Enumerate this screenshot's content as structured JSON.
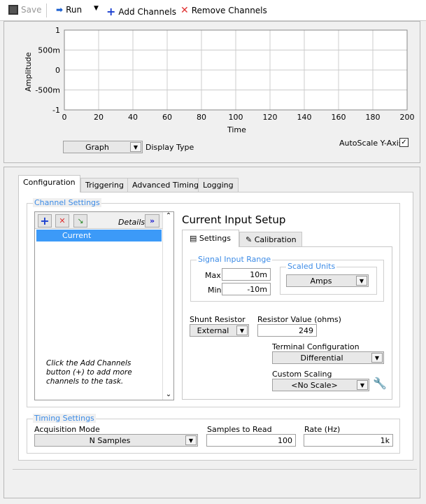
{
  "toolbar": {
    "save": "Save",
    "run": "Run",
    "add_channels": "Add Channels",
    "remove_channels": "Remove Channels"
  },
  "graph": {
    "y_label": "Amplitude",
    "x_label": "Time",
    "y_ticks": [
      "1",
      "500m",
      "0",
      "-500m",
      "-1"
    ],
    "x_ticks": [
      "0",
      "20",
      "40",
      "60",
      "80",
      "100",
      "120",
      "140",
      "160",
      "180",
      "200"
    ],
    "display_type_value": "Graph",
    "display_type_label": "Display Type",
    "autoscale_label": "AutoScale Y-Axis",
    "autoscale_checked": true
  },
  "tabs": [
    "Configuration",
    "Triggering",
    "Advanced Timing",
    "Logging"
  ],
  "channel_settings": {
    "title": "Channel Settings",
    "details": "Details",
    "channels": [
      "Current"
    ],
    "hint": "Click the Add Channels button (+) to add more channels to the task."
  },
  "setup": {
    "title": "Current Input Setup",
    "tabs": [
      "Settings",
      "Calibration"
    ],
    "signal_range": "Signal Input Range",
    "max_label": "Max",
    "max": "10m",
    "min_label": "Min",
    "min": "-10m",
    "scaled_units_label": "Scaled Units",
    "scaled_units": "Amps",
    "shunt_label": "Shunt Resistor",
    "shunt": "External",
    "resistor_label": "Resistor Value (ohms)",
    "resistor": "249",
    "terminal_label": "Terminal Configuration",
    "terminal": "Differential",
    "scaling_label": "Custom Scaling",
    "scaling": "<No Scale>"
  },
  "timing": {
    "title": "Timing Settings",
    "mode_label": "Acquisition Mode",
    "mode": "N Samples",
    "samples_label": "Samples to Read",
    "samples": "100",
    "rate_label": "Rate (Hz)",
    "rate": "1k"
  }
}
